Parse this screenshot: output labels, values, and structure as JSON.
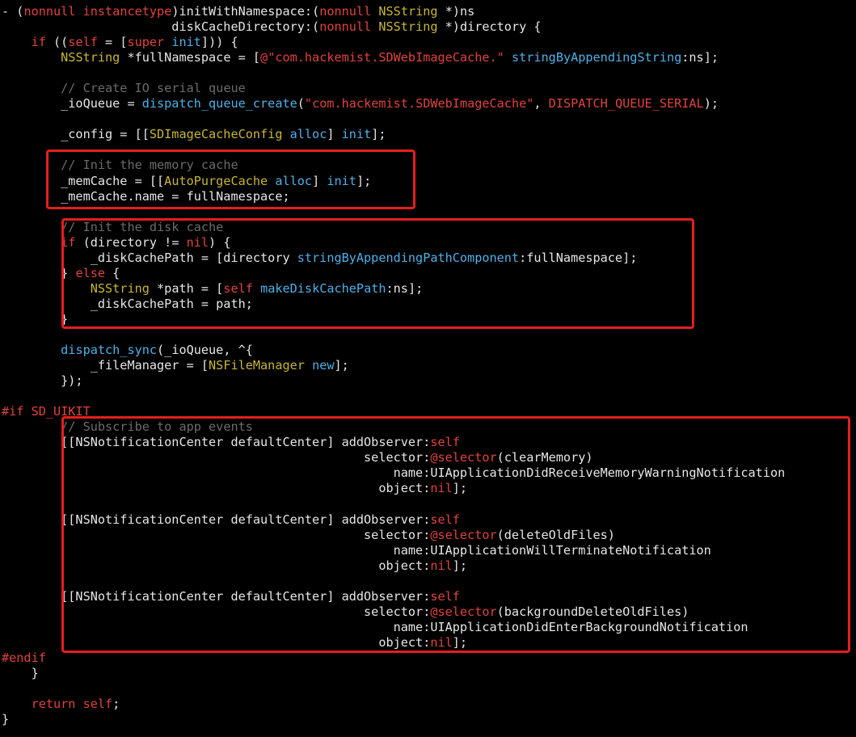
{
  "editor": {
    "lines": [
      [
        [
          "plain",
          "- ("
        ],
        [
          "kw",
          "nonnull"
        ],
        [
          "plain",
          " "
        ],
        [
          "kw",
          "instancetype"
        ],
        [
          "plain",
          ")initWithNamespace:("
        ],
        [
          "kw",
          "nonnull"
        ],
        [
          "plain",
          " "
        ],
        [
          "type",
          "NSString"
        ],
        [
          "plain",
          " *)ns"
        ]
      ],
      [
        [
          "plain",
          "                       diskCacheDirectory:("
        ],
        [
          "kw",
          "nonnull"
        ],
        [
          "plain",
          " "
        ],
        [
          "type",
          "NSString"
        ],
        [
          "plain",
          " *)directory {"
        ]
      ],
      [
        [
          "plain",
          "    "
        ],
        [
          "kw",
          "if"
        ],
        [
          "plain",
          " (("
        ],
        [
          "kw",
          "self"
        ],
        [
          "plain",
          " = ["
        ],
        [
          "kw",
          "super"
        ],
        [
          "plain",
          " "
        ],
        [
          "method",
          "init"
        ],
        [
          "plain",
          "])) {"
        ]
      ],
      [
        [
          "plain",
          "        "
        ],
        [
          "type",
          "NSString"
        ],
        [
          "plain",
          " *fullNamespace = ["
        ],
        [
          "str",
          "@\"com.hackemist.SDWebImageCache.\""
        ],
        [
          "plain",
          " "
        ],
        [
          "method",
          "stringByAppendingString"
        ],
        [
          "plain",
          ":ns];"
        ]
      ],
      [
        [
          "plain",
          ""
        ]
      ],
      [
        [
          "plain",
          "        "
        ],
        [
          "comment",
          "// Create IO serial queue"
        ]
      ],
      [
        [
          "plain",
          "        _ioQueue = "
        ],
        [
          "method",
          "dispatch_queue_create"
        ],
        [
          "plain",
          "("
        ],
        [
          "str",
          "\"com.hackemist.SDWebImageCache\""
        ],
        [
          "plain",
          ", "
        ],
        [
          "macro",
          "DISPATCH_QUEUE_SERIAL"
        ],
        [
          "plain",
          ");"
        ]
      ],
      [
        [
          "plain",
          ""
        ]
      ],
      [
        [
          "plain",
          "        _config = [["
        ],
        [
          "type",
          "SDImageCacheConfig"
        ],
        [
          "plain",
          " "
        ],
        [
          "method",
          "alloc"
        ],
        [
          "plain",
          "] "
        ],
        [
          "method",
          "init"
        ],
        [
          "plain",
          "];"
        ]
      ],
      [
        [
          "plain",
          ""
        ]
      ],
      [
        [
          "plain",
          "        "
        ],
        [
          "comment",
          "// Init the memory cache"
        ]
      ],
      [
        [
          "plain",
          "        _memCache = [["
        ],
        [
          "type",
          "AutoPurgeCache"
        ],
        [
          "plain",
          " "
        ],
        [
          "method",
          "alloc"
        ],
        [
          "plain",
          "] "
        ],
        [
          "method",
          "init"
        ],
        [
          "plain",
          "];"
        ]
      ],
      [
        [
          "plain",
          "        _memCache.name = fullNamespace;"
        ]
      ],
      [
        [
          "plain",
          ""
        ]
      ],
      [
        [
          "plain",
          "        "
        ],
        [
          "comment",
          "// Init the disk cache"
        ]
      ],
      [
        [
          "plain",
          "        "
        ],
        [
          "kw",
          "if"
        ],
        [
          "plain",
          " (directory != "
        ],
        [
          "kw",
          "nil"
        ],
        [
          "plain",
          ") {"
        ]
      ],
      [
        [
          "plain",
          "            _diskCachePath = [directory "
        ],
        [
          "method",
          "stringByAppendingPathComponent"
        ],
        [
          "plain",
          ":fullNamespace];"
        ]
      ],
      [
        [
          "plain",
          "        } "
        ],
        [
          "kw",
          "else"
        ],
        [
          "plain",
          " {"
        ]
      ],
      [
        [
          "plain",
          "            "
        ],
        [
          "type",
          "NSString"
        ],
        [
          "plain",
          " *path = ["
        ],
        [
          "kw",
          "self"
        ],
        [
          "plain",
          " "
        ],
        [
          "method",
          "makeDiskCachePath"
        ],
        [
          "plain",
          ":ns];"
        ]
      ],
      [
        [
          "plain",
          "            _diskCachePath = path;"
        ]
      ],
      [
        [
          "plain",
          "        }"
        ]
      ],
      [
        [
          "plain",
          ""
        ]
      ],
      [
        [
          "plain",
          "        "
        ],
        [
          "method",
          "dispatch_sync"
        ],
        [
          "plain",
          "(_ioQueue, ^{"
        ]
      ],
      [
        [
          "plain",
          "            _fileManager = ["
        ],
        [
          "type",
          "NSFileManager"
        ],
        [
          "plain",
          " "
        ],
        [
          "method",
          "new"
        ],
        [
          "plain",
          "];"
        ]
      ],
      [
        [
          "plain",
          "        });"
        ]
      ],
      [
        [
          "plain",
          ""
        ]
      ],
      [
        [
          "macro",
          "#if SD_UIKIT"
        ]
      ],
      [
        [
          "plain",
          "        "
        ],
        [
          "comment",
          "// Subscribe to app events"
        ]
      ],
      [
        [
          "plain",
          "        [[NSNotificationCenter defaultCenter] addObserver:"
        ],
        [
          "kw",
          "self"
        ]
      ],
      [
        [
          "plain",
          "                                                 selector:"
        ],
        [
          "kw",
          "@selector"
        ],
        [
          "plain",
          "(clearMemory)"
        ]
      ],
      [
        [
          "plain",
          "                                                     name:UIApplicationDidReceiveMemoryWarningNotification"
        ]
      ],
      [
        [
          "plain",
          "                                                   object:"
        ],
        [
          "kw",
          "nil"
        ],
        [
          "plain",
          "];"
        ]
      ],
      [
        [
          "plain",
          ""
        ]
      ],
      [
        [
          "plain",
          "        [[NSNotificationCenter defaultCenter] addObserver:"
        ],
        [
          "kw",
          "self"
        ]
      ],
      [
        [
          "plain",
          "                                                 selector:"
        ],
        [
          "kw",
          "@selector"
        ],
        [
          "plain",
          "(deleteOldFiles)"
        ]
      ],
      [
        [
          "plain",
          "                                                     name:UIApplicationWillTerminateNotification"
        ]
      ],
      [
        [
          "plain",
          "                                                   object:"
        ],
        [
          "kw",
          "nil"
        ],
        [
          "plain",
          "];"
        ]
      ],
      [
        [
          "plain",
          ""
        ]
      ],
      [
        [
          "plain",
          "        [[NSNotificationCenter defaultCenter] addObserver:"
        ],
        [
          "kw",
          "self"
        ]
      ],
      [
        [
          "plain",
          "                                                 selector:"
        ],
        [
          "kw",
          "@selector"
        ],
        [
          "plain",
          "(backgroundDeleteOldFiles)"
        ]
      ],
      [
        [
          "plain",
          "                                                     name:UIApplicationDidEnterBackgroundNotification"
        ]
      ],
      [
        [
          "plain",
          "                                                   object:"
        ],
        [
          "kw",
          "nil"
        ],
        [
          "plain",
          "];"
        ]
      ],
      [
        [
          "macro",
          "#endif"
        ]
      ],
      [
        [
          "plain",
          "    }"
        ]
      ],
      [
        [
          "plain",
          ""
        ]
      ],
      [
        [
          "plain",
          "    "
        ],
        [
          "kw",
          "return"
        ],
        [
          "plain",
          " "
        ],
        [
          "kw",
          "self"
        ],
        [
          "plain",
          ";"
        ]
      ],
      [
        [
          "plain",
          "}"
        ]
      ]
    ]
  },
  "annotations": {
    "box_color": "#e51e1e"
  },
  "theme": {
    "background": "#000000",
    "plain": "#e6e6e6",
    "keyword": "#e0433e",
    "type": "#c8b636",
    "method": "#4fb0e8",
    "comment": "#6b6b6b"
  }
}
